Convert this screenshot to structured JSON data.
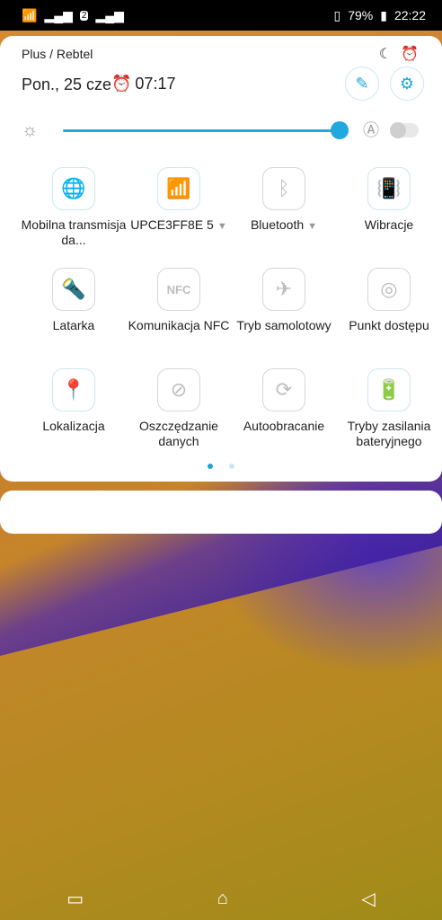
{
  "status": {
    "battery": "79%",
    "time": "22:22",
    "sim_badge": "2"
  },
  "panel": {
    "carrier": "Plus / Rebtel",
    "date": "Pon., 25 cze",
    "alarm": "07:17"
  },
  "tiles": [
    {
      "label": "Mobilna transmisja da...",
      "icon": "globe-4g-icon",
      "on": true
    },
    {
      "label": "UPCE3FF8E 5",
      "icon": "wifi-icon",
      "on": true
    },
    {
      "label": "Bluetooth",
      "icon": "bluetooth-icon",
      "on": false
    },
    {
      "label": "Wibracje",
      "icon": "vibrate-icon",
      "on": true
    },
    {
      "label": "Latarka",
      "icon": "flashlight-icon",
      "on": false
    },
    {
      "label": "Komunikacja NFC",
      "icon": "nfc-icon",
      "on": false
    },
    {
      "label": "Tryb samolotowy",
      "icon": "airplane-icon",
      "on": false
    },
    {
      "label": "Punkt dostępu",
      "icon": "hotspot-icon",
      "on": false
    },
    {
      "label": "Lokalizacja",
      "icon": "location-icon",
      "on": true
    },
    {
      "label": "Oszczędzanie danych",
      "icon": "data-saver-icon",
      "on": false
    },
    {
      "label": "Autoobracanie",
      "icon": "autorotate-icon",
      "on": false
    },
    {
      "label": "Tryby zasilania bateryjnego",
      "icon": "battery-mode-icon",
      "on": true
    }
  ],
  "brightness": {
    "level_fraction": 0.96,
    "auto": false
  },
  "colors": {
    "accent": "#1aa6d6"
  }
}
